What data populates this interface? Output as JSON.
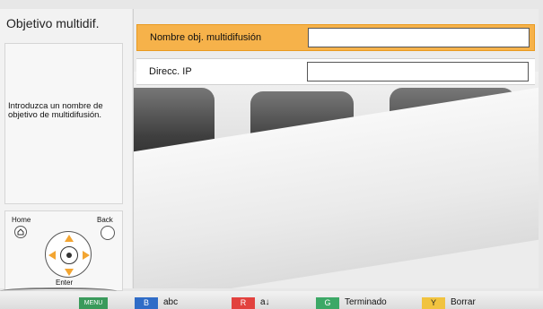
{
  "title": "Objetivo multidif.",
  "help_text": "Introduzca un nombre de objetivo de multidifusión.",
  "form": {
    "fields": [
      {
        "label": "Nombre obj. multidifusión",
        "value": ""
      },
      {
        "label": "Direcc. IP",
        "value": ""
      }
    ]
  },
  "nav": {
    "home_label": "Home",
    "back_label": "Back",
    "enter_label": "Enter",
    "icons": [
      "home-icon",
      "back-icon",
      "dpad-icon"
    ]
  },
  "keys": {
    "menu": {
      "chip": "MENU",
      "label": ""
    },
    "blue": {
      "chip": "B",
      "label": "abc"
    },
    "red": {
      "chip": "R",
      "label": "a↓"
    },
    "green": {
      "chip": "G",
      "label": "Terminado"
    },
    "yellow": {
      "chip": "Y",
      "label": "Borrar"
    }
  },
  "colors": {
    "highlight": "#f6b24a",
    "blue": "#2f6cc7",
    "red": "#e2413e",
    "green": "#3ca866",
    "yellow": "#f1c33f"
  }
}
